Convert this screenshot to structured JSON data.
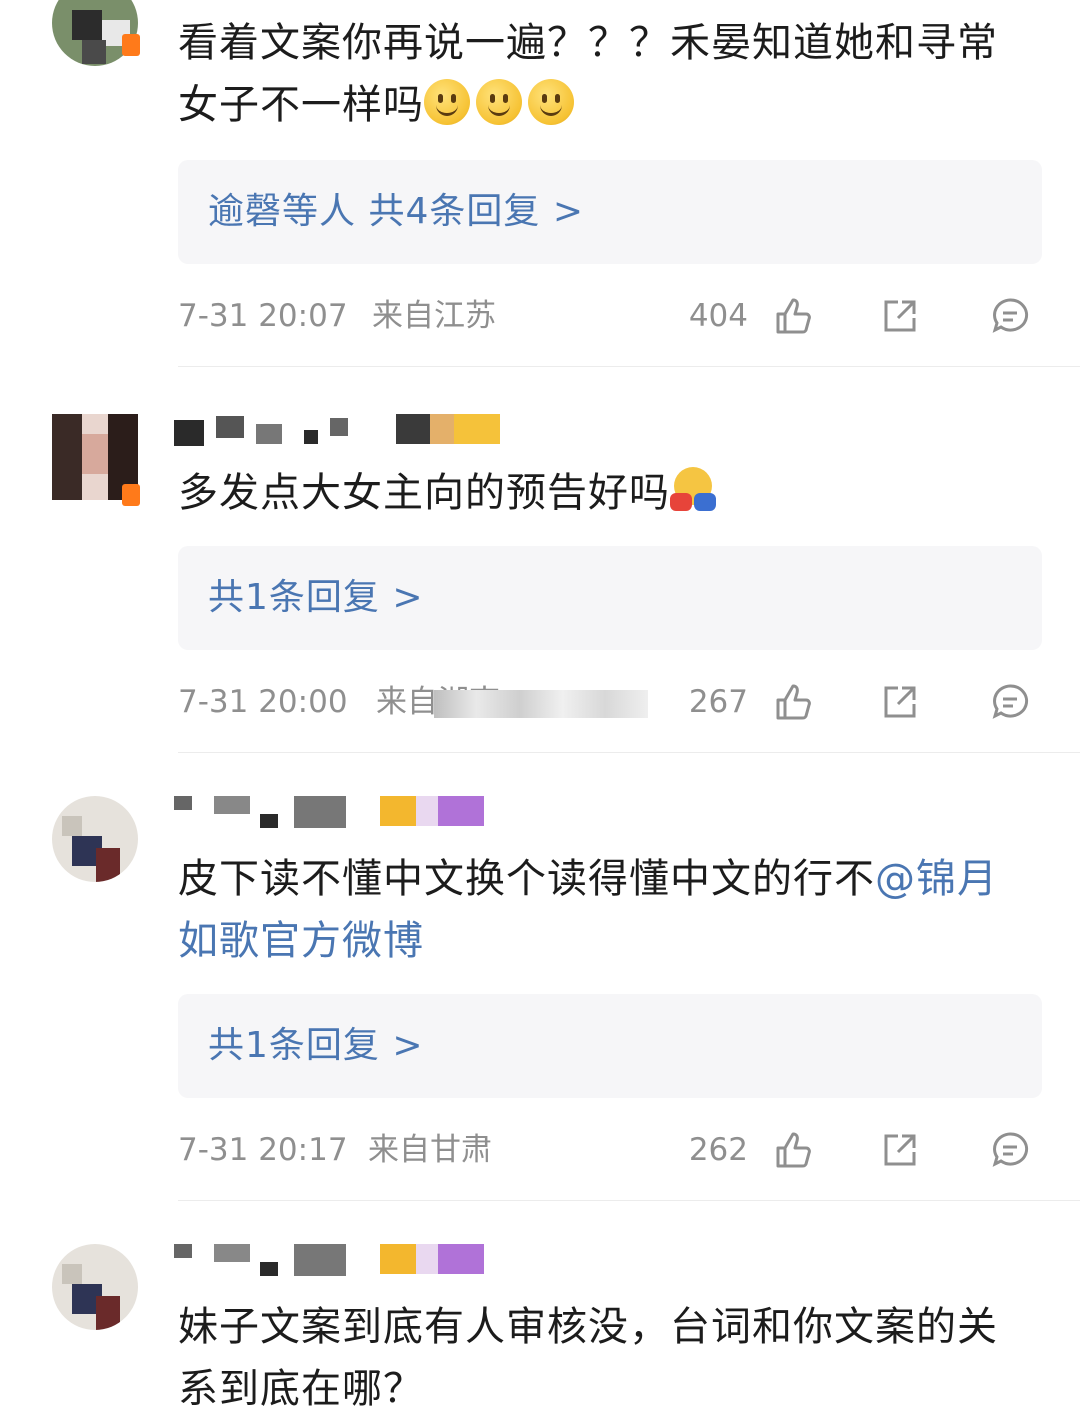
{
  "comments": [
    {
      "text": "看着文案你再说一遍？？？禾晏知道她和寻常女子不一样吗",
      "reply_prefix": "逾磬等人",
      "reply_label": "共4条回复 >",
      "time": "7-31 20:07",
      "location": "来自江苏",
      "likes": "404"
    },
    {
      "text": "多发点大女主向的预告好吗",
      "reply_label": "共1条回复 >",
      "time": "7-31 20:00",
      "location": "来自湖南",
      "likes": "267"
    },
    {
      "text": "皮下读不懂中文换个读得懂中文的行不",
      "mention": "@锦月如歌官方微博",
      "reply_label": "共1条回复 >",
      "time": "7-31 20:17",
      "location": "来自甘肃",
      "likes": "262"
    },
    {
      "text": "妹子文案到底有人审核没，台词和你文案的关系到底在哪？"
    }
  ],
  "icons": {
    "like": "thumbs-up-icon",
    "share": "share-icon",
    "comment": "comment-icon",
    "smile": "smile-emoji-icon",
    "hug": "hug-emoji-icon"
  },
  "colors": {
    "link": "#4a76b2",
    "meta": "#8f8f8f",
    "reply_bg": "#f6f6f8"
  }
}
